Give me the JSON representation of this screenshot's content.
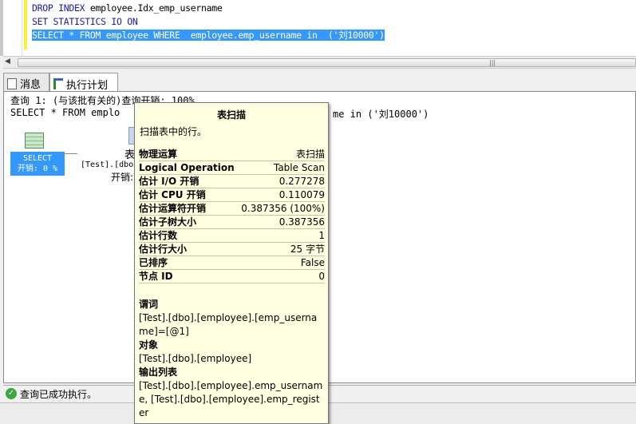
{
  "editor": {
    "line1_kw": "DROP INDEX",
    "line1_rest": " employee.Idx_emp_username",
    "line2": "SET STATISTICS IO ON",
    "line3": "SELECT * FROM employee WHERE  employee.emp_username in  ('刘10000')"
  },
  "tabs": [
    {
      "label": "消息",
      "icon": "message-icon"
    },
    {
      "label": "执行计划",
      "icon": "plan-icon"
    }
  ],
  "results": {
    "query_header": "查询 1: (与该批有关的)查询开销: 100%",
    "query_sql": "SELECT * FROM emplo",
    "query_sql_tail": "me in ('刘10000')",
    "select_node": {
      "label": "SELECT",
      "cost": "开销: 0 %"
    },
    "scan_node": {
      "label": "表",
      "table": "[Test].[dbo",
      "cost": "开销:"
    }
  },
  "tooltip": {
    "title": "表扫描",
    "description": "扫描表中的行。",
    "rows": [
      {
        "k": "物理运算",
        "v": "表扫描"
      },
      {
        "k": "Logical Operation",
        "v": "Table Scan"
      },
      {
        "k": "估计 I/O 开销",
        "v": "0.277278"
      },
      {
        "k": "估计 CPU 开销",
        "v": "0.110079"
      },
      {
        "k": "估计运算符开销",
        "v": "0.387356 (100%)"
      },
      {
        "k": "估计子树大小",
        "v": "0.387356"
      },
      {
        "k": "估计行数",
        "v": "1"
      },
      {
        "k": "估计行大小",
        "v": "25 字节"
      },
      {
        "k": "已排序",
        "v": "False"
      },
      {
        "k": "节点 ID",
        "v": "0"
      }
    ],
    "predicate_label": "谓词",
    "predicate": "[Test].[dbo].[employee].[emp_username]=[@1]",
    "object_label": "对象",
    "object": "[Test].[dbo].[employee]",
    "output_label": "输出列表",
    "output": "[Test].[dbo].[employee].emp_username, [Test].[dbo].[employee].emp_register"
  },
  "status": {
    "text": "查询已成功执行。"
  }
}
